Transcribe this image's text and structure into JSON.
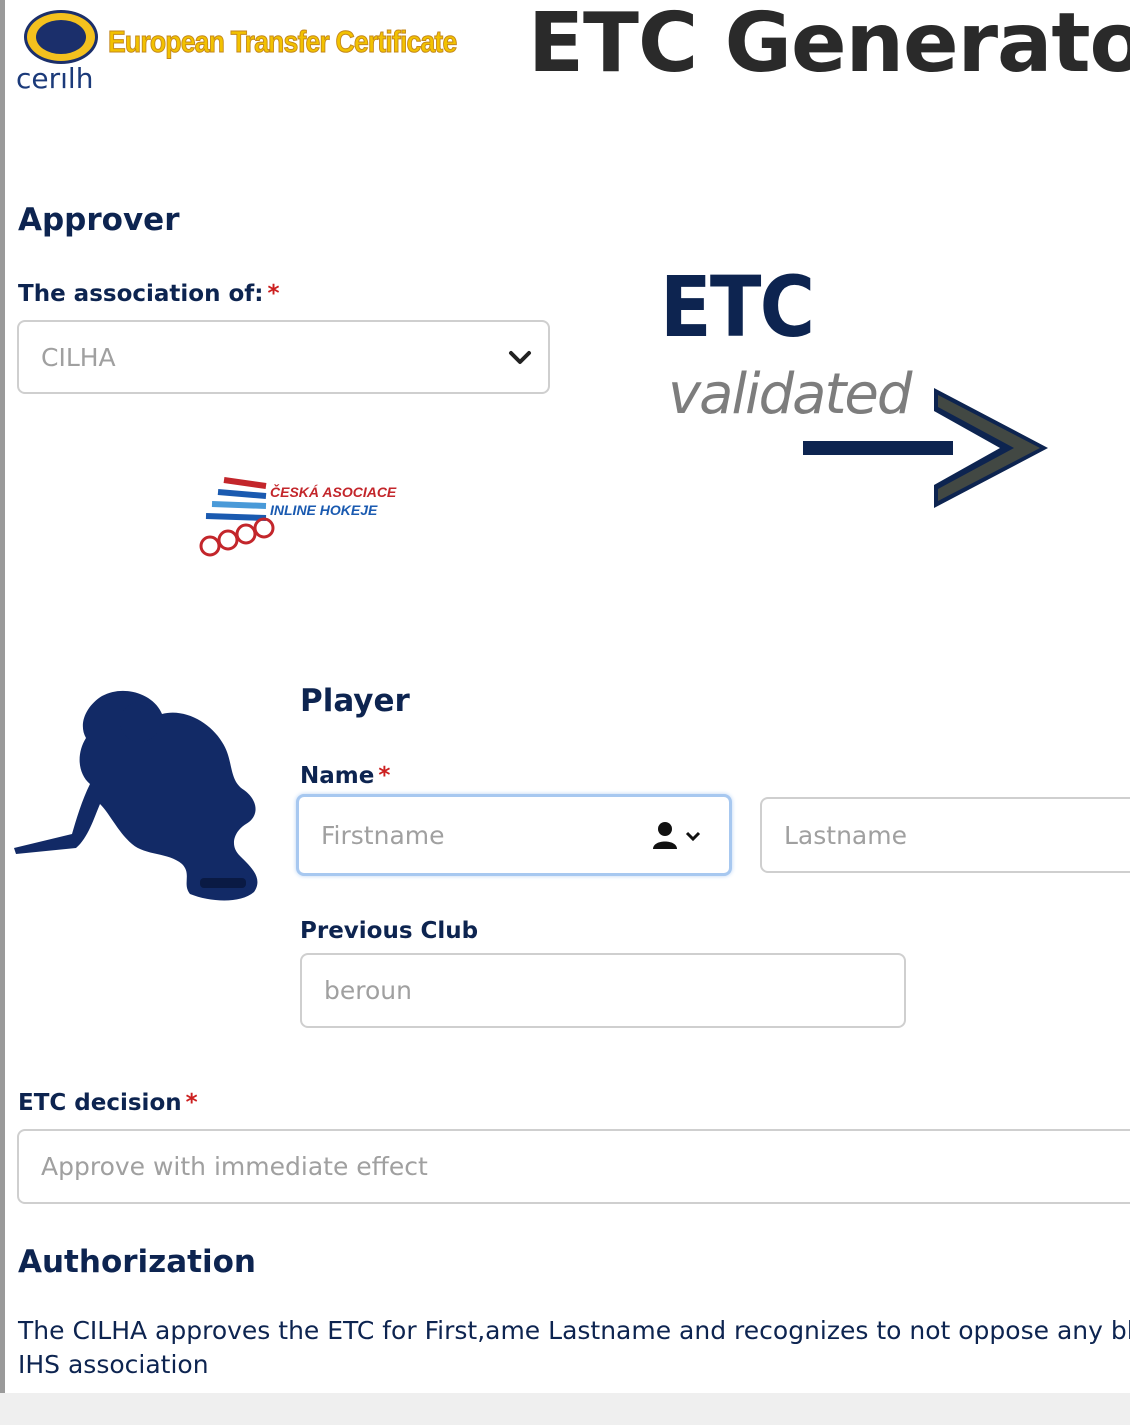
{
  "header": {
    "logo_text": "cerılh",
    "subtitle": "European Transfer Certificate",
    "title": "ETC Generator"
  },
  "approver": {
    "heading": "Approver",
    "association_label": "The association of:",
    "association_value": "CILHA",
    "association_logo_text": [
      "ČESKÁ ASOCIACE",
      "INLINE HOKEJE"
    ]
  },
  "etc_badge": {
    "big_text": "ETC",
    "sub_text": "validated"
  },
  "player": {
    "heading": "Player",
    "name_label": "Name",
    "firstname_placeholder": "Firstname",
    "lastname_placeholder": "Lastname",
    "previous_club_label": "Previous Club",
    "previous_club_value": "beroun"
  },
  "decision": {
    "label": "ETC decision",
    "value": "Approve with immediate effect"
  },
  "authorization": {
    "heading": "Authorization",
    "text_line1": "The CILHA approves the ETC for First,ame Lastname and recognizes to not oppose any bl",
    "text_line2": "IHS association"
  },
  "required_mark": "*",
  "colors": {
    "navy": "#0d2450",
    "required": "#cc1f1f",
    "gold": "#f2c200",
    "focus_ring": "#a7c8f0"
  }
}
